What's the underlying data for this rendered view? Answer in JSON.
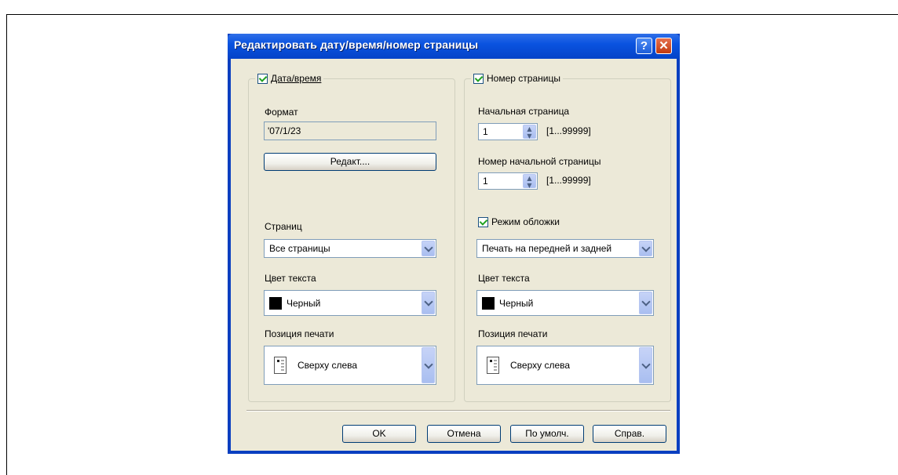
{
  "dialog": {
    "title": "Редактировать дату/время/номер страницы",
    "help_glyph": "?",
    "close_glyph": "✕"
  },
  "date_group": {
    "checkbox_label": "Дата/время",
    "format_label": "Формат",
    "format_value": "'07/1/23",
    "edit_button": "Редакт....",
    "pages_label": "Страниц",
    "pages_value": "Все страницы",
    "text_color_label": "Цвет текста",
    "text_color_value": "Черный",
    "print_position_label": "Позиция печати",
    "print_position_value": "Сверху слева"
  },
  "page_group": {
    "checkbox_label": "Номер страницы",
    "start_page_label": "Начальная страница",
    "start_page_value": "1",
    "start_page_range": "[1...99999]",
    "start_number_label": "Номер начальной страницы",
    "start_number_value": "1",
    "start_number_range": "[1...99999]",
    "cover_mode_label": "Режим обложки",
    "cover_mode_value": "Печать на передней и задней",
    "text_color_label": "Цвет текста",
    "text_color_value": "Черный",
    "print_position_label": "Позиция печати",
    "print_position_value": "Сверху слева"
  },
  "buttons": {
    "ok": "OK",
    "cancel": "Отмена",
    "default": "По умолч.",
    "help": "Справ."
  },
  "colors": {
    "title_bar": "#0a53e0",
    "face": "#ece9d8",
    "check": "#21a121"
  },
  "icons": {
    "checkbox": "checkmark-icon",
    "combo": "chevron-down-icon",
    "spin": "spin-arrows-icon",
    "position": "page-position-icon"
  }
}
